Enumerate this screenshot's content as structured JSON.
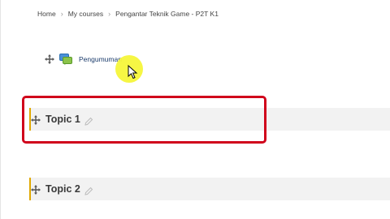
{
  "breadcrumb": {
    "items": [
      "Home",
      "My courses",
      "Pengantar Teknik Game - P2T K1"
    ],
    "separator": "›"
  },
  "activity": {
    "label": "Pengumuman",
    "icon": "forum-icon"
  },
  "sections": [
    {
      "title": "Topic 1",
      "highlighted": true
    },
    {
      "title": "Topic 2",
      "highlighted": false
    }
  ],
  "colors": {
    "highlight_box": "#d0021b",
    "section_accent": "#e0a800",
    "cursor_halo": "#f5f53a",
    "link": "#1a3b6b"
  }
}
